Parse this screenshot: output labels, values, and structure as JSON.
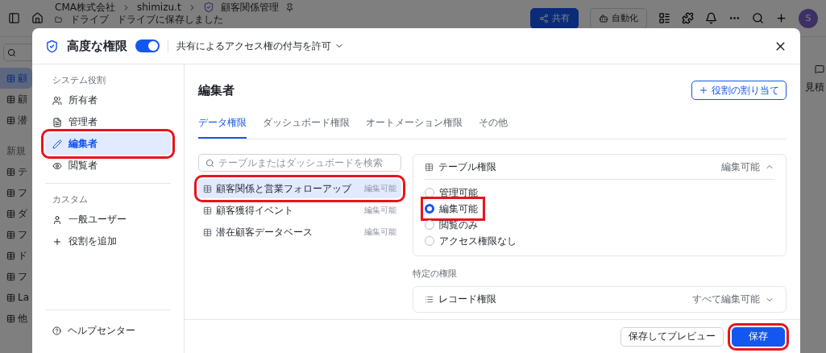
{
  "background": {
    "breadcrumb": [
      "CMA株式会社",
      "shimizu.t",
      "顧客関係管理"
    ],
    "location": {
      "folder": "ドライブ",
      "status": "ドライブに保存しました"
    },
    "actions": [
      {
        "label": "共有",
        "kind": "primary"
      },
      {
        "label": "自動化",
        "kind": "outline"
      }
    ],
    "avatar": "S",
    "sidebar": [
      {
        "label": "顧",
        "kind": "item",
        "selected": true
      },
      {
        "label": "顧",
        "kind": "item",
        "selected": false
      },
      {
        "label": "潜",
        "kind": "item",
        "selected": false
      },
      {
        "label": "新規",
        "kind": "heading"
      },
      {
        "label": "テ",
        "kind": "item",
        "selected": false
      },
      {
        "label": "フ",
        "kind": "item",
        "selected": false
      },
      {
        "label": "ダ",
        "kind": "item",
        "selected": false
      },
      {
        "label": "フ",
        "kind": "item",
        "selected": false
      },
      {
        "label": "ド",
        "kind": "item",
        "selected": false
      },
      {
        "label": "フ",
        "kind": "item",
        "selected": false
      },
      {
        "label": "La",
        "kind": "item",
        "selected": false
      },
      {
        "label": "他",
        "kind": "item",
        "selected": false
      }
    ],
    "right_peek": "見積"
  },
  "modal": {
    "title": "高度な権限",
    "toggle": {
      "on": true
    },
    "sharing_option": "共有によるアクセス権の付与を許可",
    "sidebar": {
      "sections": [
        {
          "label": "システム役割",
          "items": [
            {
              "label": "所有者",
              "selected": false,
              "highlighted": false
            },
            {
              "label": "管理者",
              "selected": false,
              "highlighted": false
            },
            {
              "label": "編集者",
              "selected": true,
              "highlighted": true
            },
            {
              "label": "閲覧者",
              "selected": false,
              "highlighted": false
            }
          ]
        },
        {
          "label": "カスタム",
          "items": [
            {
              "label": "一般ユーザー",
              "selected": false,
              "highlighted": false
            },
            {
              "label": "役割を追加",
              "selected": false,
              "highlighted": false
            }
          ]
        }
      ],
      "help": "ヘルプセンター"
    },
    "role_title": "編集者",
    "assign_button": "役割の割り当て",
    "tabs": [
      {
        "label": "データ権限",
        "selected": true
      },
      {
        "label": "ダッシュボード権限",
        "selected": false
      },
      {
        "label": "オートメーション権限",
        "selected": false
      },
      {
        "label": "その他",
        "selected": false
      }
    ],
    "search": {
      "placeholder": "テーブルまたはダッシュボードを検索"
    },
    "tables": [
      {
        "name": "顧客関係と営業フォローアップ",
        "permission": "編集可能",
        "selected": true,
        "highlighted": true
      },
      {
        "name": "顧客獲得イベント",
        "permission": "編集可能",
        "selected": false,
        "highlighted": false
      },
      {
        "name": "潜在顧客データベース",
        "permission": "編集可能",
        "selected": false,
        "highlighted": false
      }
    ],
    "table_permission": {
      "title": "テーブル権限",
      "value": "編集可能",
      "expanded": true,
      "options": [
        {
          "label": "管理可能",
          "selected": false,
          "highlighted": false
        },
        {
          "label": "編集可能",
          "selected": true,
          "highlighted": true
        },
        {
          "label": "閲覧のみ",
          "selected": false,
          "highlighted": false
        },
        {
          "label": "アクセス権限なし",
          "selected": false,
          "highlighted": false
        }
      ]
    },
    "specific_label": "特定の権限",
    "record_permission": {
      "title": "レコード権限",
      "value": "すべて編集可能",
      "expanded": false
    },
    "footer_buttons": [
      {
        "label": "保存してプレビュー",
        "kind": "secondary",
        "highlighted": false
      },
      {
        "label": "保存",
        "kind": "primary",
        "highlighted": true
      }
    ]
  }
}
